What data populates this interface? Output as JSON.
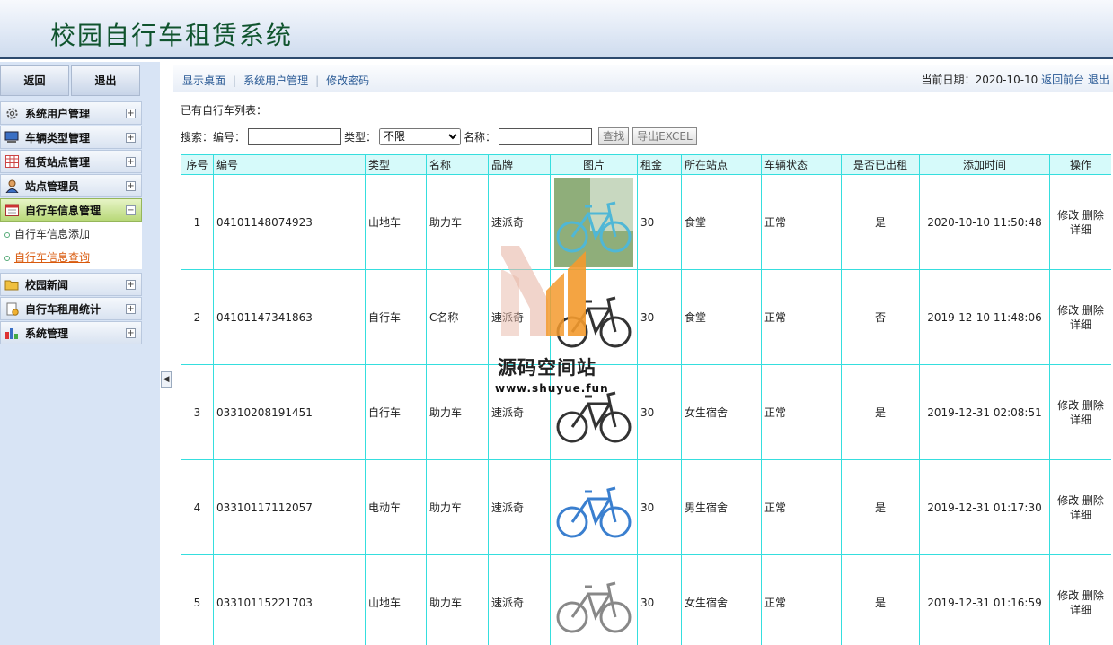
{
  "app": {
    "title": "校园自行车租赁系统"
  },
  "sidebar": {
    "back_label": "返回",
    "logout_label": "退出",
    "menu": [
      {
        "label": "系统用户管理",
        "icon": "gear-icon"
      },
      {
        "label": "车辆类型管理",
        "icon": "monitor-icon"
      },
      {
        "label": "租赁站点管理",
        "icon": "grid-icon"
      },
      {
        "label": "站点管理员",
        "icon": "user-icon"
      },
      {
        "label": "自行车信息管理",
        "icon": "calendar-icon",
        "expanded": true,
        "children": [
          {
            "label": "自行车信息添加"
          },
          {
            "label": "自行车信息查询",
            "current": true
          }
        ]
      },
      {
        "label": "校园新闻",
        "icon": "folder-icon"
      },
      {
        "label": "自行车租用统计",
        "icon": "document-icon"
      },
      {
        "label": "系统管理",
        "icon": "bar-chart-icon"
      }
    ]
  },
  "topnav": {
    "links": [
      "显示桌面",
      "系统用户管理",
      "修改密码"
    ],
    "date_label": "当前日期：",
    "date": "2020-10-10",
    "back_front": "返回前台",
    "logout": "退出"
  },
  "list_label": "已有自行车列表：",
  "search": {
    "prefix": "搜索：",
    "code_label": "编号：",
    "type_label": "类型：",
    "type_selected": "不限",
    "name_label": "名称：",
    "search_button": "查找",
    "export_button": "导出EXCEL"
  },
  "table": {
    "headers": [
      "序号",
      "编号",
      "类型",
      "名称",
      "品牌",
      "图片",
      "租金",
      "所在站点",
      "车辆状态",
      "是否已出租",
      "添加时间",
      "操作"
    ],
    "edit": "修改",
    "delete": "删除",
    "detail": "详细",
    "rows": [
      {
        "no": "1",
        "code": "04101148074923",
        "type": "山地车",
        "name": "助力车",
        "brand": "速派奇",
        "rent": "30",
        "station": "食堂",
        "status": "正常",
        "rented": "是",
        "added": "2020-10-10 11:50:48"
      },
      {
        "no": "2",
        "code": "04101147341863",
        "type": "自行车",
        "name": "C名称",
        "brand": "速派奇",
        "rent": "30",
        "station": "食堂",
        "status": "正常",
        "rented": "否",
        "added": "2019-12-10 11:48:06"
      },
      {
        "no": "3",
        "code": "03310208191451",
        "type": "自行车",
        "name": "助力车",
        "brand": "速派奇",
        "rent": "30",
        "station": "女生宿舍",
        "status": "正常",
        "rented": "是",
        "added": "2019-12-31 02:08:51"
      },
      {
        "no": "4",
        "code": "03310117112057",
        "type": "电动车",
        "name": "助力车",
        "brand": "速派奇",
        "rent": "30",
        "station": "男生宿舍",
        "status": "正常",
        "rented": "是",
        "added": "2019-12-31 01:17:30"
      },
      {
        "no": "5",
        "code": "03310115221703",
        "type": "山地车",
        "name": "助力车",
        "brand": "速派奇",
        "rent": "30",
        "station": "女生宿舍",
        "status": "正常",
        "rented": "是",
        "added": "2019-12-31 01:16:59"
      }
    ]
  },
  "watermark": {
    "name": "源码空间站",
    "url": "www.shuyue.fun"
  },
  "colors": {
    "header_title": "#10542e",
    "table_border": "#35dede",
    "table_header_bg": "#d6fafa",
    "active_menu": "#b8d878",
    "link": "#2a5a95"
  }
}
